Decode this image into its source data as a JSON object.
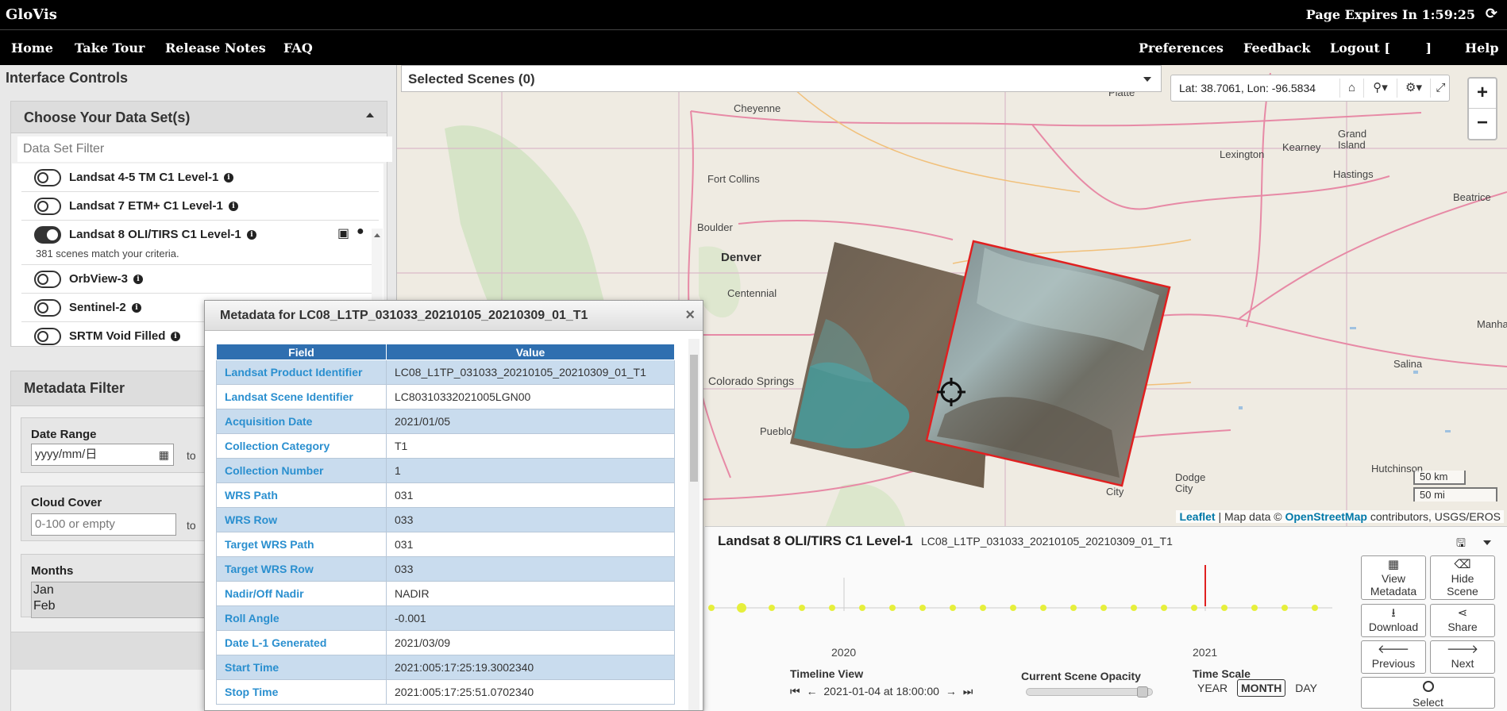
{
  "app": {
    "brand": "GloVis",
    "expires": "Page Expires In 1:59:25",
    "refresh_icon": "refresh-icon"
  },
  "nav": {
    "left": [
      "Home",
      "Take Tour",
      "Release Notes",
      "FAQ"
    ],
    "right": [
      "Preferences",
      "Feedback",
      "Logout [        ]",
      "Help"
    ]
  },
  "left_panel": {
    "title": "Interface Controls",
    "datasets_box": {
      "title": "Choose Your Data Set(s)",
      "filter_placeholder": "Data Set Filter",
      "items": [
        {
          "name": "Landsat 4-5 TM C1 Level-1",
          "on": false
        },
        {
          "name": "Landsat 7 ETM+ C1 Level-1",
          "on": false
        },
        {
          "name": "Landsat 8 OLI/TIRS C1 Level-1",
          "on": true,
          "note": "381 scenes match your criteria."
        },
        {
          "name": "OrbView-3",
          "on": false
        },
        {
          "name": "Sentinel-2",
          "on": false
        },
        {
          "name": "SRTM Void Filled",
          "on": false
        }
      ]
    },
    "metadata_filter": {
      "title": "Metadata Filter",
      "date_range_label": "Date Range",
      "date_placeholder": "yyyy/mm/日",
      "to": "to",
      "cloud_cover_label": "Cloud Cover",
      "cloud_placeholder": "0-100 or empty",
      "months_label": "Months",
      "months": [
        "Jan",
        "Feb"
      ]
    }
  },
  "map": {
    "selected_scenes": "Selected Scenes (0)",
    "coords": "Lat: 38.7061, Lon: -96.5834",
    "zoom_in": "+",
    "zoom_out": "−",
    "scale_km": "50 km",
    "scale_mi": "50 mi",
    "attribution": {
      "leaflet": "Leaflet",
      "mid": " | Map data © ",
      "osm": "OpenStreetMap",
      "end": " contributors, USGS/EROS"
    },
    "cities": [
      {
        "name": "Cheyenne"
      },
      {
        "name": "Fort Collins"
      },
      {
        "name": "Boulder"
      },
      {
        "name": "Denver"
      },
      {
        "name": "Centennial"
      },
      {
        "name": "Colorado Springs"
      },
      {
        "name": "Pueblo"
      },
      {
        "name": "Lexington"
      },
      {
        "name": "Kearney"
      },
      {
        "name": "Grand\nIsland"
      },
      {
        "name": "Hastings"
      },
      {
        "name": "Beatrice"
      },
      {
        "name": "Salina"
      },
      {
        "name": "Hutchinson"
      },
      {
        "name": "Dodge\nCity"
      },
      {
        "name": "City"
      },
      {
        "name": "North\nPlatte"
      },
      {
        "name": "Manha"
      }
    ]
  },
  "bottom": {
    "title": "Landsat 8 OLI/TIRS C1 Level-1",
    "scene_id": "LC08_L1TP_031033_20210105_20210309_01_T1",
    "year_labels": [
      "2020",
      "2021"
    ],
    "timeline_view_label": "Timeline View",
    "timeline_date": "2021-01-04 at 18:00:00",
    "opacity_label": "Current Scene Opacity",
    "opacity": 0.95,
    "time_scale_label": "Time Scale",
    "time_scale": [
      "YEAR",
      "MONTH",
      "DAY"
    ],
    "buttons": {
      "view_metadata": "View\nMetadata",
      "hide_scene": "Hide\nScene",
      "download": "Download",
      "share": "Share",
      "previous": "Previous",
      "next": "Next",
      "select": "Select"
    }
  },
  "metadata_dialog": {
    "title": "Metadata for LC08_L1TP_031033_20210105_20210309_01_T1",
    "headers": [
      "Field",
      "Value"
    ],
    "rows": [
      [
        "Landsat Product Identifier",
        "LC08_L1TP_031033_20210105_20210309_01_T1"
      ],
      [
        "Landsat Scene Identifier",
        "LC80310332021005LGN00"
      ],
      [
        "Acquisition Date",
        "2021/01/05"
      ],
      [
        "Collection Category",
        "T1"
      ],
      [
        "Collection Number",
        "1"
      ],
      [
        "WRS Path",
        "031"
      ],
      [
        "WRS Row",
        "033"
      ],
      [
        "Target WRS Path",
        "031"
      ],
      [
        "Target WRS Row",
        "033"
      ],
      [
        "Nadir/Off Nadir",
        "NADIR"
      ],
      [
        "Roll Angle",
        "-0.001"
      ],
      [
        "Date L-1 Generated",
        "2021/03/09"
      ],
      [
        "Start Time",
        "2021:005:17:25:19.3002340"
      ],
      [
        "Stop Time",
        "2021:005:17:25:51.0702340"
      ]
    ]
  },
  "colors": {
    "table_header": "#2f6fb0",
    "field_text": "#2a8fcf",
    "row_alt": "#c9dcee",
    "selected_scene_border": "#e02020",
    "timeline_dot": "#e6ef3c"
  }
}
